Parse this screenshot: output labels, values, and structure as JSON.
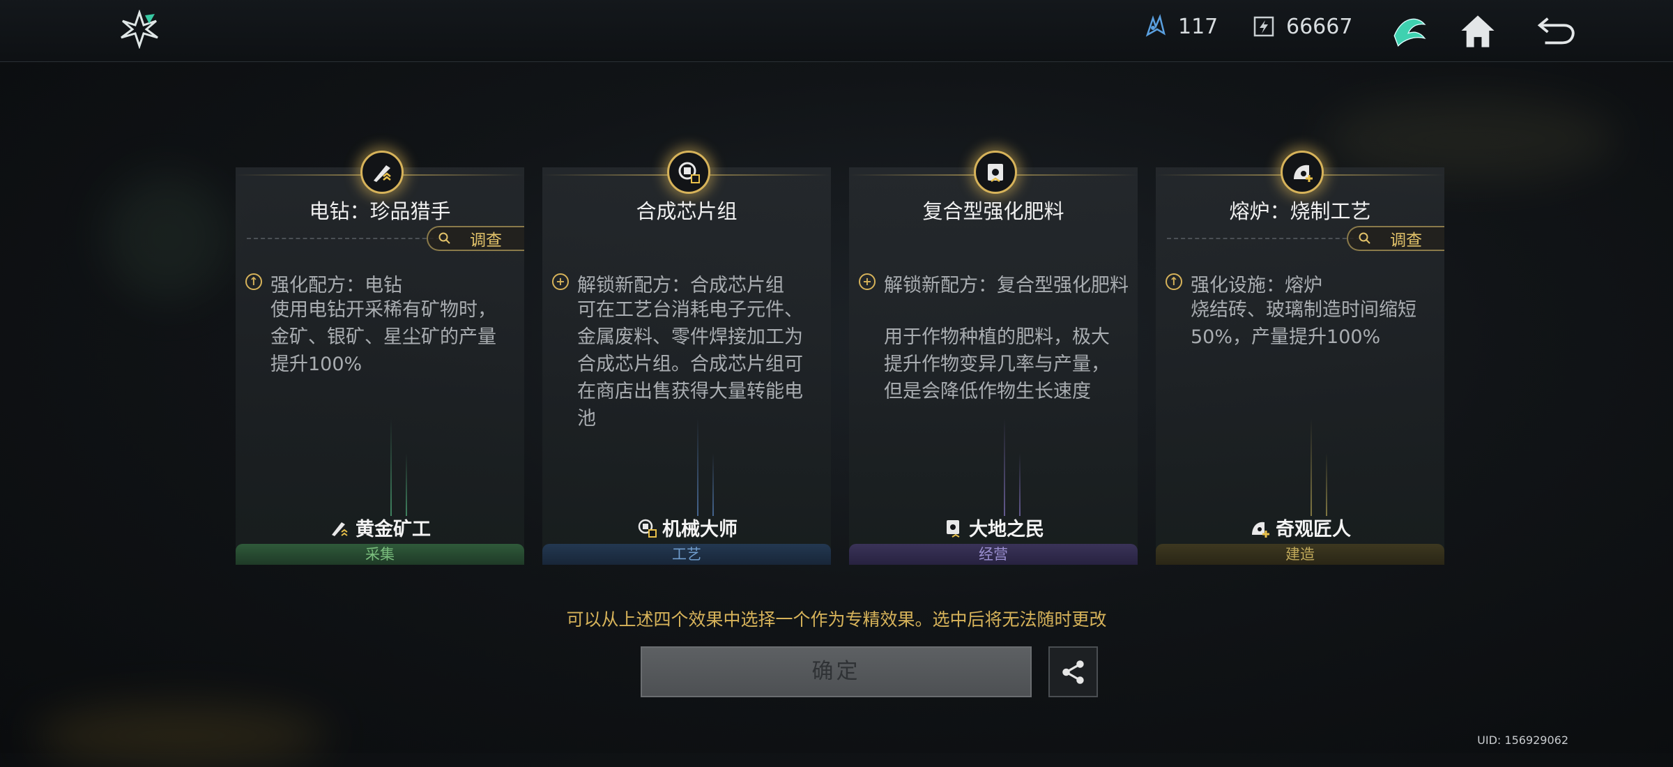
{
  "header": {
    "currency_1": {
      "icon": "crystal-icon",
      "value": "117"
    },
    "currency_2": {
      "icon": "energy-chip-icon",
      "value": "66667"
    },
    "buttons": [
      "faction-emblem-icon",
      "home-icon",
      "back-icon"
    ]
  },
  "cards": [
    {
      "title": "电钻：珍品猎手",
      "has_investigate": true,
      "effect_icon": "upgrade-icon",
      "effect_title": "强化配方：电钻",
      "effect_desc": "使用电钻开采稀有矿物时，金矿、银矿、星尘矿的产量提升100%",
      "tag": "黄金矿工",
      "category": "采集",
      "color": "#2f5a3a",
      "cat_text_color": "#7bbf7e"
    },
    {
      "title": "合成芯片组",
      "has_investigate": false,
      "effect_icon": "unlock-icon",
      "effect_title": "解锁新配方：合成芯片组",
      "effect_desc": "可在工艺台消耗电子元件、金属废料、零件焊接加工为合成芯片组。合成芯片组可在商店出售获得大量转能电池",
      "tag": "机械大师",
      "category": "工艺",
      "color": "#233851",
      "cat_text_color": "#6f9ccc"
    },
    {
      "title": "复合型强化肥料",
      "has_investigate": false,
      "effect_icon": "unlock-icon",
      "effect_title": "解锁新配方：复合型强化肥料",
      "effect_desc": "用于作物种植的肥料，极大提升作物变异几率与产量，但是会降低作物生长速度",
      "tag": "大地之民",
      "category": "经营",
      "color": "#3a3358",
      "cat_text_color": "#9a8fd0"
    },
    {
      "title": "熔炉：烧制工艺",
      "has_investigate": true,
      "effect_icon": "upgrade-icon",
      "effect_title": "强化设施：熔炉",
      "effect_desc": "烧结砖、玻璃制造时间缩短50%，产量提升100%",
      "tag": "奇观匠人",
      "category": "建造",
      "color": "#3d3820",
      "cat_text_color": "#c0a95a"
    }
  ],
  "investigate_label": "调查",
  "hint": "可以从上述四个效果中选择一个作为专精效果。选中后将无法随时更改",
  "confirm_label": "确定",
  "uid": "UID: 156929062"
}
